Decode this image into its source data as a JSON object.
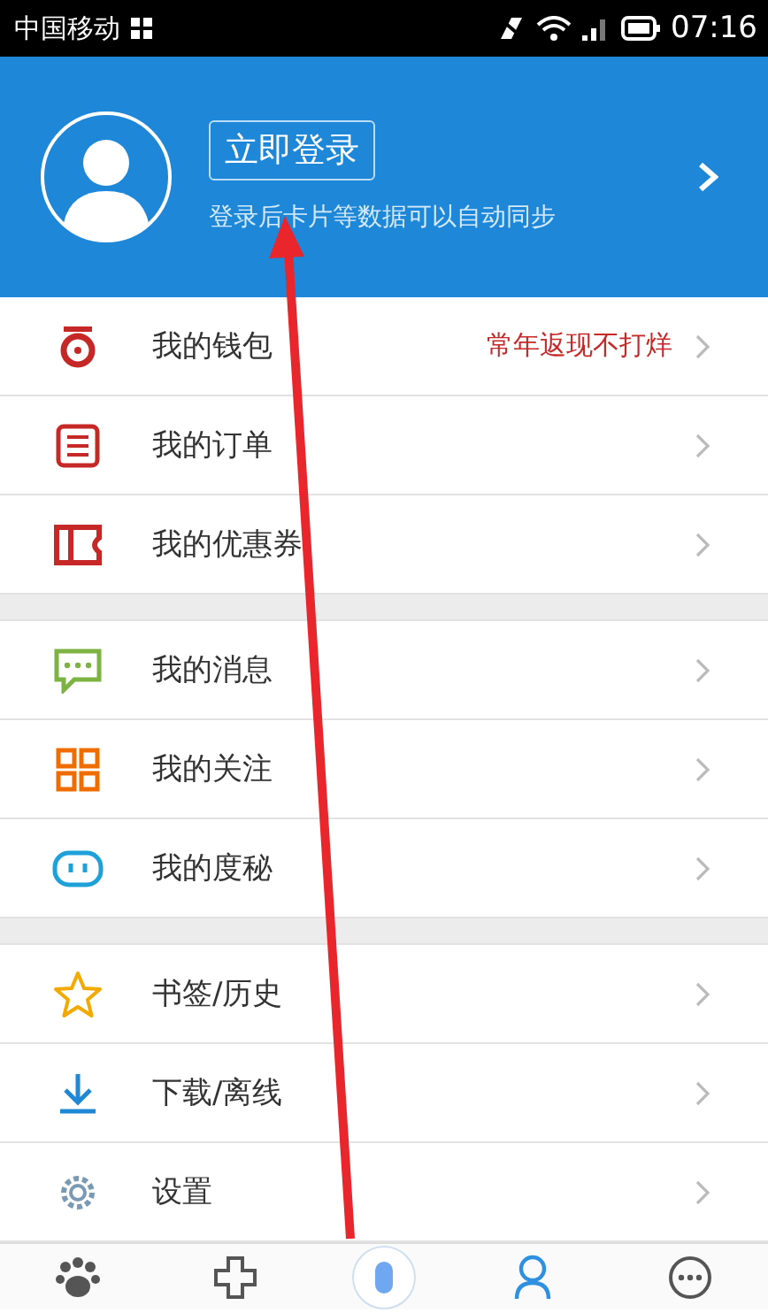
{
  "status_bar": {
    "carrier": "中国移动",
    "time": "07:16"
  },
  "profile": {
    "login_button": "立即登录",
    "hint": "登录后卡片等数据可以自动同步"
  },
  "menu_groups": [
    {
      "items": [
        {
          "kind": "wallet",
          "label": "我的钱包",
          "note": "常年返现不打烊"
        },
        {
          "kind": "orders",
          "label": "我的订单"
        },
        {
          "kind": "coupons",
          "label": "我的优惠券"
        }
      ]
    },
    {
      "items": [
        {
          "kind": "messages",
          "label": "我的消息"
        },
        {
          "kind": "follows",
          "label": "我的关注"
        },
        {
          "kind": "assistant",
          "label": "我的度秘"
        }
      ]
    },
    {
      "items": [
        {
          "kind": "bookmarks",
          "label": "书签/历史"
        },
        {
          "kind": "downloads",
          "label": "下载/离线"
        },
        {
          "kind": "settings",
          "label": "设置"
        }
      ]
    }
  ],
  "bottom_nav": [
    {
      "kind": "home",
      "selected": false
    },
    {
      "kind": "health",
      "selected": false
    },
    {
      "kind": "voice",
      "selected": false
    },
    {
      "kind": "me",
      "selected": true
    },
    {
      "kind": "more",
      "selected": false
    }
  ]
}
